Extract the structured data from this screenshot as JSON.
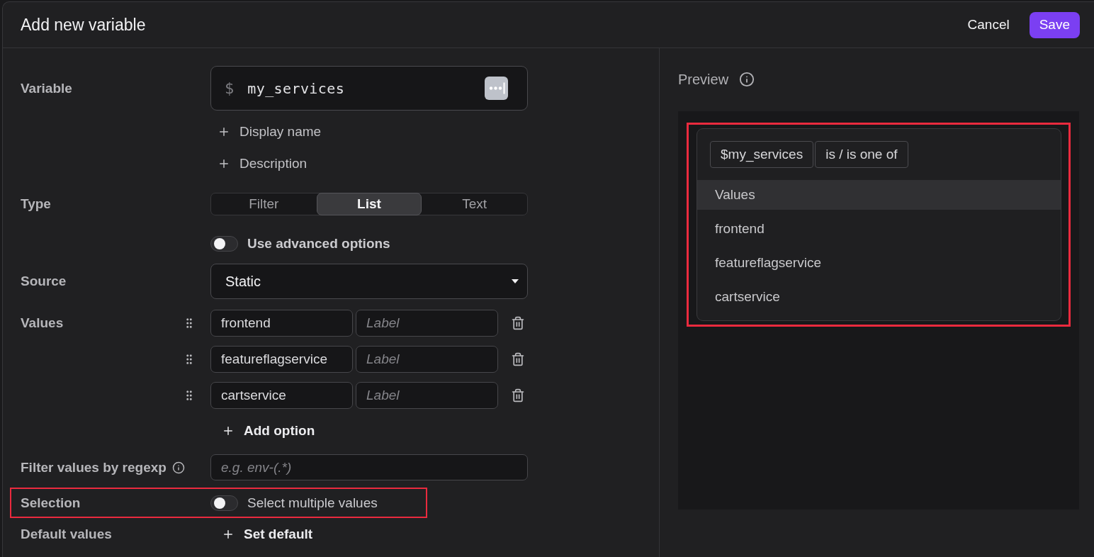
{
  "dialog": {
    "title": "Add new variable"
  },
  "actions": [
    {
      "label": "Cancel",
      "kind": "secondary"
    },
    {
      "label": "Save",
      "kind": "primary"
    }
  ],
  "form": {
    "variable": {
      "label": "Variable",
      "prefix": "$",
      "value": "my_services"
    },
    "extras": [
      {
        "label": "Display name"
      },
      {
        "label": "Description"
      }
    ],
    "type": {
      "label": "Type",
      "options": [
        {
          "label": "Filter",
          "selected": false
        },
        {
          "label": "List",
          "selected": true
        },
        {
          "label": "Text",
          "selected": false
        }
      ]
    },
    "advanced": {
      "label": "Use advanced options",
      "on": false
    },
    "source": {
      "label": "Source",
      "value": "Static"
    },
    "values": {
      "label": "Values",
      "rows": [
        {
          "value": "frontend",
          "placeholder": "Label"
        },
        {
          "value": "featureflagservice",
          "placeholder": "Label"
        },
        {
          "value": "cartservice",
          "placeholder": "Label"
        }
      ],
      "add_label": "Add option"
    },
    "regexp": {
      "label": "Filter values by regexp",
      "placeholder": "e.g. env-(.*)"
    },
    "selection": {
      "label": "Selection",
      "toggle_label": "Select multiple values",
      "on": false,
      "highlighted": true
    },
    "default_values": {
      "label": "Default values",
      "add_label": "Set default"
    }
  },
  "preview": {
    "title": "Preview",
    "highlighted": true,
    "chips": [
      "$my_services",
      "is / is one of"
    ],
    "options": [
      {
        "label": "Values",
        "selected": true
      },
      {
        "label": "frontend",
        "selected": false
      },
      {
        "label": "featureflagservice",
        "selected": false
      },
      {
        "label": "cartservice",
        "selected": false
      }
    ]
  }
}
